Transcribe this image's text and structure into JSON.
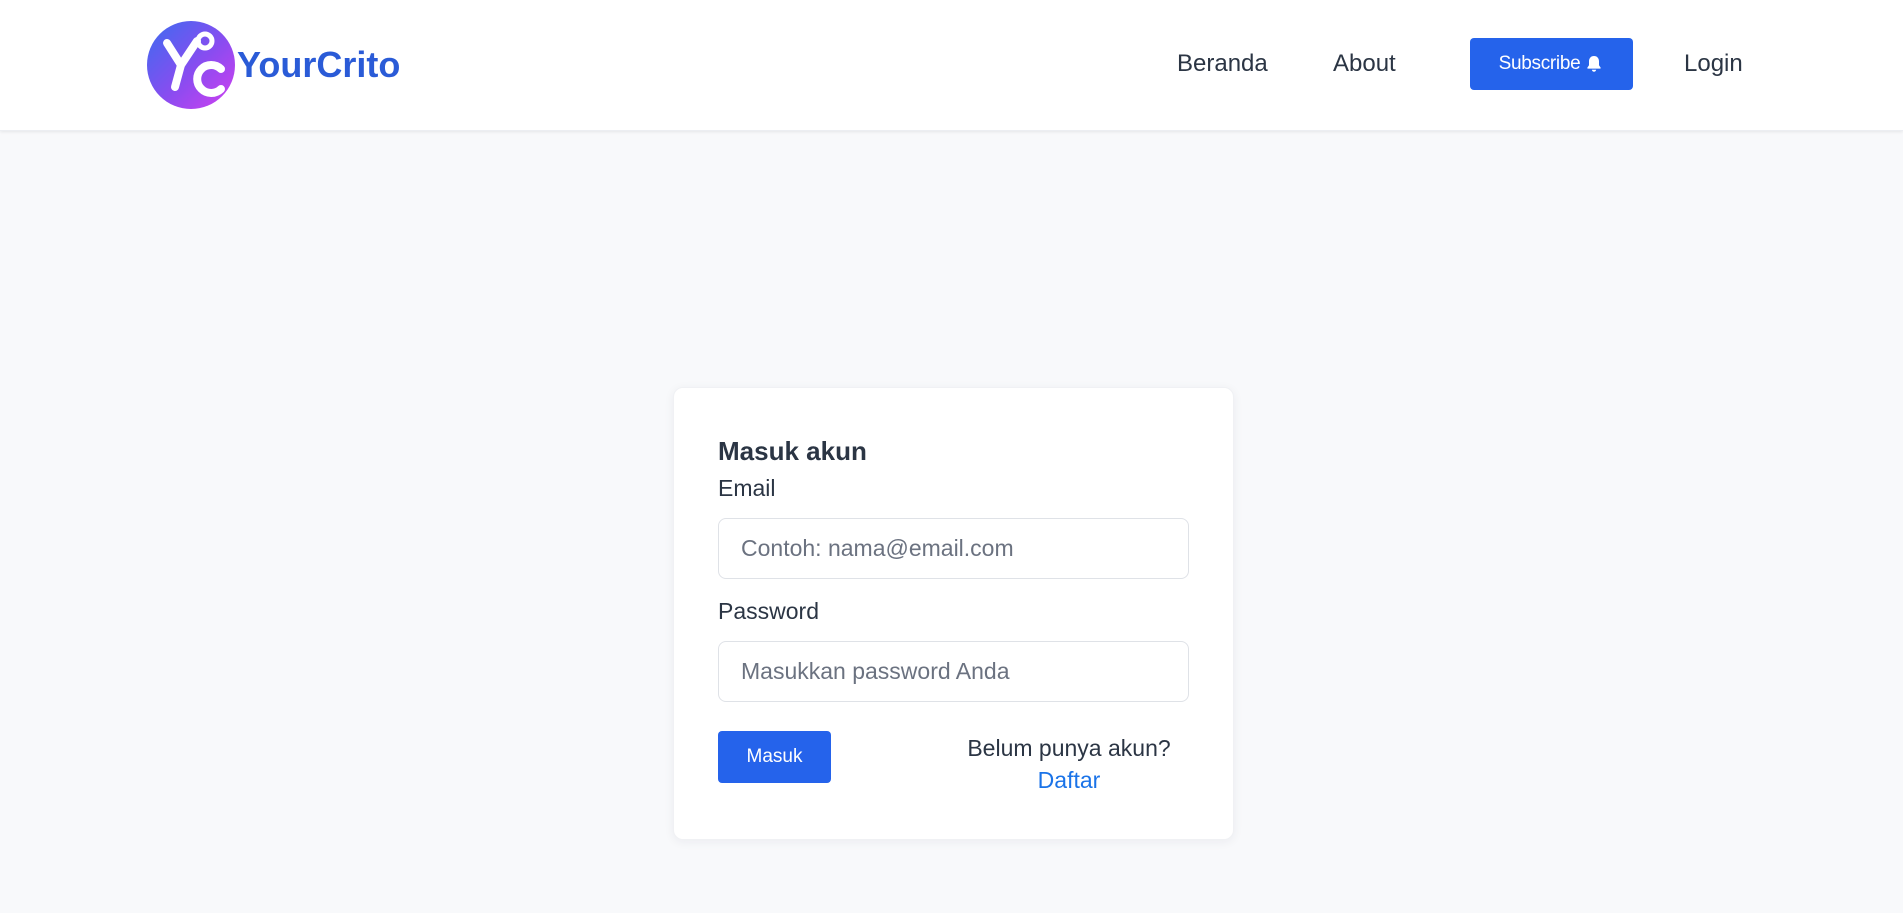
{
  "header": {
    "brand_name": "YourCrito",
    "logo_icon": "yc-logo-icon",
    "nav": {
      "beranda": "Beranda",
      "about": "About",
      "subscribe": "Subscribe",
      "login": "Login"
    }
  },
  "login_form": {
    "title": "Masuk akun",
    "email_label": "Email",
    "email_placeholder": "Contoh: nama@email.com",
    "email_value": "",
    "password_label": "Password",
    "password_placeholder": "Masukkan password Anda",
    "password_value": "",
    "submit_label": "Masuk",
    "register_prompt": "Belum punya akun?",
    "register_link": "Daftar"
  },
  "colors": {
    "accent": "#2563eb",
    "brand_text": "#2a5bd7",
    "link": "#1a73e8",
    "page_bg": "#f8f9fb"
  }
}
